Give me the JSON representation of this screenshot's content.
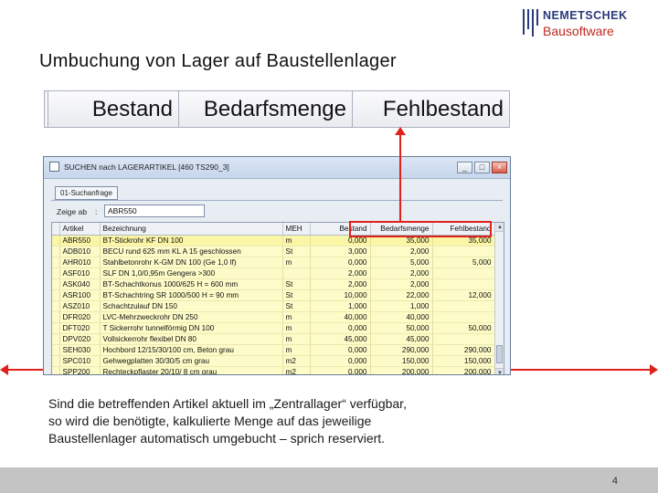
{
  "logo": {
    "name": "NEMETSCHEK",
    "subtitle": "Bausoftware"
  },
  "slide": {
    "title": "Umbuchung von Lager auf  Baustellenlager",
    "page_number": "4",
    "body_lines": [
      "Sind die betreffenden Artikel aktuell im „Zentrallager“ verfügbar,",
      "so wird die benötigte, kalkulierte Menge auf das jeweilige",
      "Baustellenlager automatisch umgebucht – sprich reserviert."
    ]
  },
  "zoom_header": {
    "col1": "Bestand",
    "col2": "Bedarfsmenge",
    "col3": "Fehlbestand"
  },
  "window": {
    "title": "SUCHEN nach LAGERARTIKEL  [460   TS290_3]",
    "minimize": "_",
    "maximize": "□",
    "close": "×",
    "tab_label": "01-Suchanfrage",
    "filter_label": "Zeige ab",
    "filter_colon": ":",
    "filter_value": "ABR550"
  },
  "grid": {
    "columns": [
      "Artikel",
      "Bezeichnung",
      "MEH",
      "Bestand",
      "Bedarfsmenge",
      "Fehlbestand"
    ],
    "rows": [
      [
        "ABR550",
        "BT-Stickrohr KF DN 100",
        "m",
        "0,000",
        "35,000",
        "35,000"
      ],
      [
        "ADB010",
        "BECU rund 625 mm KL A 15 geschlossen",
        "St",
        "3,000",
        "2,000",
        ""
      ],
      [
        "AHR010",
        "Stahlbetonrohr K-GM DN 100 (Ge 1,0 lf)",
        "m",
        "0,000",
        "5,000",
        "5,000"
      ],
      [
        "ASF010",
        "SLF DN 1,0/0,95m Gengera >300",
        "",
        "2,000",
        "2,000",
        ""
      ],
      [
        "ASK040",
        "BT-Schachtkonus 1000/625 H = 600 mm",
        "St",
        "2,000",
        "2,000",
        ""
      ],
      [
        "ASR100",
        "BT-Schachtring SR 1000/500  H = 90 mm",
        "St",
        "10,000",
        "22,000",
        "12,000"
      ],
      [
        "ASZ010",
        "Schachtzulauf DN 150",
        "St",
        "1,000",
        "1,000",
        ""
      ],
      [
        "DFR020",
        "LVC-Mehrzweckrohr DN 250",
        "m",
        "40,000",
        "40,000",
        ""
      ],
      [
        "DFT020",
        "T Sickerrohr tunnelförmig DN 100",
        "m",
        "0,000",
        "50,000",
        "50,000"
      ],
      [
        "DPV020",
        "Vollsickerrohr flexibel DN 80",
        "m",
        "45,000",
        "45,000",
        ""
      ],
      [
        "SEH030",
        "Hochbord 12/15/30/100 cm, Beton grau",
        "m",
        "0,000",
        "290,000",
        "290,000"
      ],
      [
        "SPC010",
        "Gehwegplatten 30/30/5 cm grau",
        "m2",
        "0,000",
        "150,000",
        "150,000"
      ],
      [
        "SPP200",
        "Rechteckpflaster 20/10/ 8 cm grau",
        "m2",
        "0,000",
        "200,000",
        "200,000"
      ]
    ]
  },
  "colors": {
    "highlight": "#e0201a",
    "grid_row_bg": "#fdfcc8",
    "logo_blue": "#2b3a7a",
    "logo_red": "#c0281e",
    "footer_bar": "#c4c4c4"
  }
}
